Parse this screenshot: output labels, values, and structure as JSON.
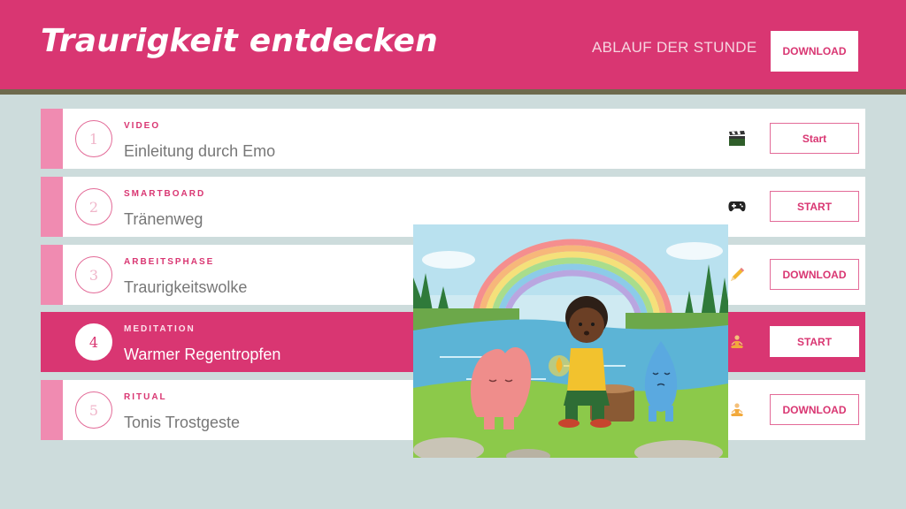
{
  "header": {
    "title": "Traurigkeit entdecken",
    "nav_label": "ABLAUF DER STUNDE",
    "download_label": "DOWNLOAD"
  },
  "steps": [
    {
      "number": "1",
      "category": "VIDEO",
      "name": "Einleitung durch Emo",
      "icon": "clapperboard-icon",
      "button": "Start",
      "active": false
    },
    {
      "number": "2",
      "category": "SMARTBOARD",
      "name": "Tränenweg",
      "icon": "gamepad-icon",
      "button": "START",
      "active": false
    },
    {
      "number": "3",
      "category": "ARBEITSPHASE",
      "name": "Traurigkeitswolke",
      "icon": "pencil-icon",
      "button": "DOWNLOAD",
      "active": false
    },
    {
      "number": "4",
      "category": "MEDITATION",
      "name": "Warmer Regentropfen",
      "icon": "meditation-icon",
      "button": "START",
      "active": true
    },
    {
      "number": "5",
      "category": "RITUAL",
      "name": "Tonis Trostgeste",
      "icon": "meditation-icon",
      "button": "DOWNLOAD",
      "active": false
    }
  ],
  "colors": {
    "accent": "#d93672",
    "bar": "#f08bb1",
    "background": "#cddcdc"
  }
}
